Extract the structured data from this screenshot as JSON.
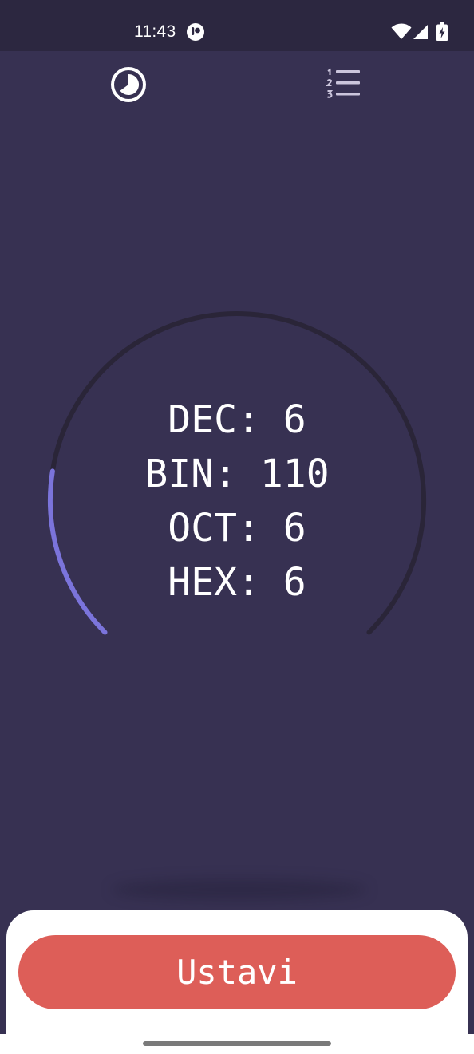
{
  "status_bar": {
    "time": "11:43",
    "icons": [
      "app-notification-icon",
      "wifi-icon",
      "cellular-signal-icon",
      "battery-charging-icon"
    ]
  },
  "top_bar": {
    "left_icon": "timer-icon",
    "right_icon": "numbered-list-icon"
  },
  "gauge": {
    "progress_fraction": 0.2,
    "progress_color": "#7b74db",
    "track_color": "#2a2538"
  },
  "readout": {
    "dec": "DEC: 6",
    "bin": "BIN: 110",
    "oct": "OCT: 6",
    "hex": "HEX: 6"
  },
  "actions": {
    "stop_label": "Ustavi",
    "stop_color": "#dd5e58"
  },
  "colors": {
    "background": "#373152",
    "status_bar": "#2c2740"
  }
}
